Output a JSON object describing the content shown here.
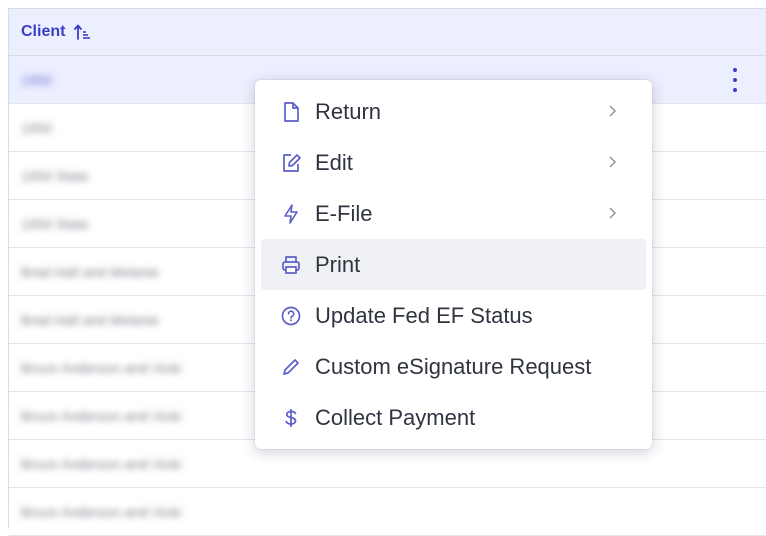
{
  "table": {
    "header": {
      "label": "Client"
    },
    "rows": [
      "1950",
      "1950",
      "1950 State",
      "1950 State",
      "Brad Hall and Melanie",
      "Brad Hall and Melanie",
      "Bruce Anderson and Vicki",
      "Bruce Anderson and Vicki",
      "Bruce Anderson and Vicki",
      "Bruce Anderson and Vicki"
    ]
  },
  "context_menu": {
    "items": [
      {
        "label": "Return",
        "icon": "document-icon",
        "has_submenu": true
      },
      {
        "label": "Edit",
        "icon": "edit-icon",
        "has_submenu": true
      },
      {
        "label": "E-File",
        "icon": "lightning-icon",
        "has_submenu": true
      },
      {
        "label": "Print",
        "icon": "printer-icon",
        "has_submenu": false
      },
      {
        "label": "Update Fed EF Status",
        "icon": "question-circle-icon",
        "has_submenu": false
      },
      {
        "label": "Custom eSignature Request",
        "icon": "pen-icon",
        "has_submenu": false
      },
      {
        "label": "Collect Payment",
        "icon": "dollar-icon",
        "has_submenu": false
      }
    ],
    "hovered_item": "Print"
  },
  "colors": {
    "accent": "#3b3fc4",
    "header_bg": "#eceffd",
    "menu_icon": "#5b5fc9",
    "hover_bg": "#f0f1f4"
  }
}
